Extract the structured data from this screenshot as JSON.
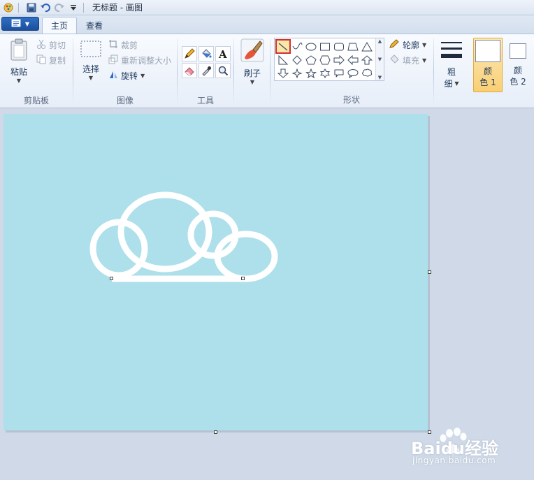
{
  "window": {
    "title": "无标题 - 画图"
  },
  "tabs": [
    {
      "label": "主页",
      "active": true
    },
    {
      "label": "查看",
      "active": false
    }
  ],
  "ribbon": {
    "clipboard": {
      "paste_label": "粘贴",
      "cut_label": "剪切",
      "copy_label": "复制",
      "group_label": "剪贴板"
    },
    "image": {
      "select_label": "选择",
      "crop_label": "裁剪",
      "resize_label": "重新调整大小",
      "rotate_label": "旋转",
      "group_label": "图像"
    },
    "tools": {
      "group_label": "工具",
      "items": [
        "pencil-icon",
        "fill-bucket-icon",
        "text-icon",
        "eraser-icon",
        "color-picker-icon",
        "magnifier-icon"
      ]
    },
    "brushes": {
      "label": "刷子"
    },
    "shapes": {
      "group_label": "形状",
      "outline_label": "轮廓",
      "fill_label": "填充",
      "selected": "line",
      "items": [
        "line",
        "curve",
        "oval",
        "rectangle",
        "rounded-rectangle",
        "polygon",
        "triangle",
        "right-triangle",
        "diamond",
        "pentagon",
        "hexagon",
        "right-arrow",
        "left-arrow",
        "up-arrow",
        "down-arrow",
        "four-point-star",
        "five-point-star",
        "six-point-star",
        "rounded-callout",
        "oval-callout",
        "cloud-callout"
      ]
    },
    "size": {
      "label_line1": "粗",
      "label_line2": "细"
    },
    "colors": {
      "color1_line1": "颜",
      "color1_line2": "色 1",
      "color2_line1": "颜",
      "color2_line2": "色 2"
    }
  },
  "canvas": {
    "background": "#ade0eb",
    "drawing": "white-cloud-outline"
  },
  "watermark": {
    "brand": "Baidu经验",
    "url": "jingyan.baidu.com"
  }
}
